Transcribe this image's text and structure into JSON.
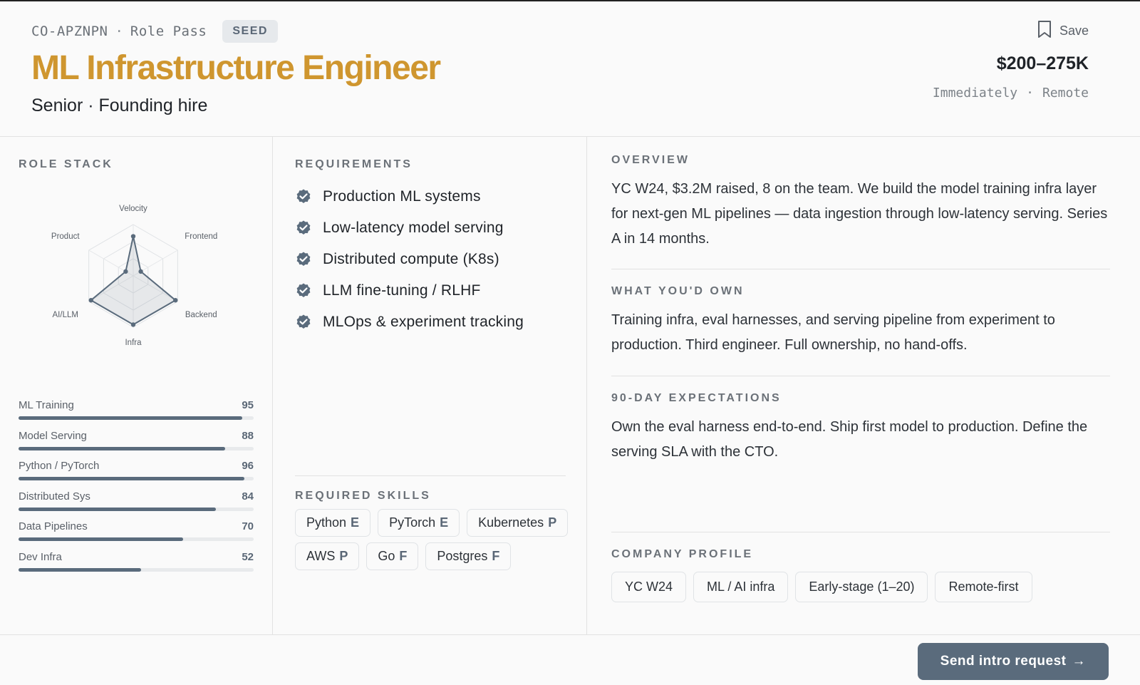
{
  "header": {
    "code": "CO-APZNPN",
    "separator": "·",
    "pass_type": "Role Pass",
    "stage_badge": "SEED",
    "title": "ML Infrastructure Engineer",
    "subtitle": "Senior · Founding hire",
    "save_label": "Save",
    "salary": "$200–275K",
    "start": "Immediately",
    "location": "Remote"
  },
  "role_stack": {
    "label": "ROLE STACK",
    "radar": {
      "axes": [
        "Velocity",
        "Frontend",
        "Backend",
        "Infra",
        "AI/LLM",
        "Product"
      ],
      "values": [
        0.77,
        0.17,
        0.95,
        0.95,
        0.95,
        0.17
      ]
    },
    "skills": [
      {
        "name": "ML Training",
        "value": 95
      },
      {
        "name": "Model Serving",
        "value": 88
      },
      {
        "name": "Python / PyTorch",
        "value": 96
      },
      {
        "name": "Distributed Sys",
        "value": 84
      },
      {
        "name": "Data Pipelines",
        "value": 70
      },
      {
        "name": "Dev Infra",
        "value": 52
      }
    ]
  },
  "requirements": {
    "label": "REQUIREMENTS",
    "items": [
      "Production ML systems",
      "Low-latency model serving",
      "Distributed compute (K8s)",
      "LLM fine-tuning / RLHF",
      "MLOps & experiment tracking"
    ]
  },
  "required_skills": {
    "label": "REQUIRED SKILLS",
    "chips": [
      {
        "name": "Python",
        "level": "E"
      },
      {
        "name": "PyTorch",
        "level": "E"
      },
      {
        "name": "Kubernetes",
        "level": "P"
      },
      {
        "name": "AWS",
        "level": "P"
      },
      {
        "name": "Go",
        "level": "F"
      },
      {
        "name": "Postgres",
        "level": "F"
      }
    ]
  },
  "overview": {
    "label": "OVERVIEW",
    "text": "YC W24, $3.2M raised, 8 on the team. We build the model training infra layer for next-gen ML pipelines — data ingestion through low-latency serving. Series A in 14 months."
  },
  "own": {
    "label": "WHAT YOU'D OWN",
    "text": "Training infra, eval harnesses, and serving pipeline from experiment to production. Third engineer. Full ownership, no hand-offs."
  },
  "expectations": {
    "label": "90-DAY EXPECTATIONS",
    "text": "Own the eval harness end-to-end. Ship first model to production. Define the serving SLA with the CTO."
  },
  "company_profile": {
    "label": "COMPANY PROFILE",
    "tags": [
      "YC W24",
      "ML / AI infra",
      "Early-stage (1–20)",
      "Remote-first"
    ]
  },
  "footer": {
    "cta_label": "Send intro request",
    "cta_arrow": "→"
  },
  "colors": {
    "accent": "#cf962f",
    "slate": "#5a6b7c"
  }
}
